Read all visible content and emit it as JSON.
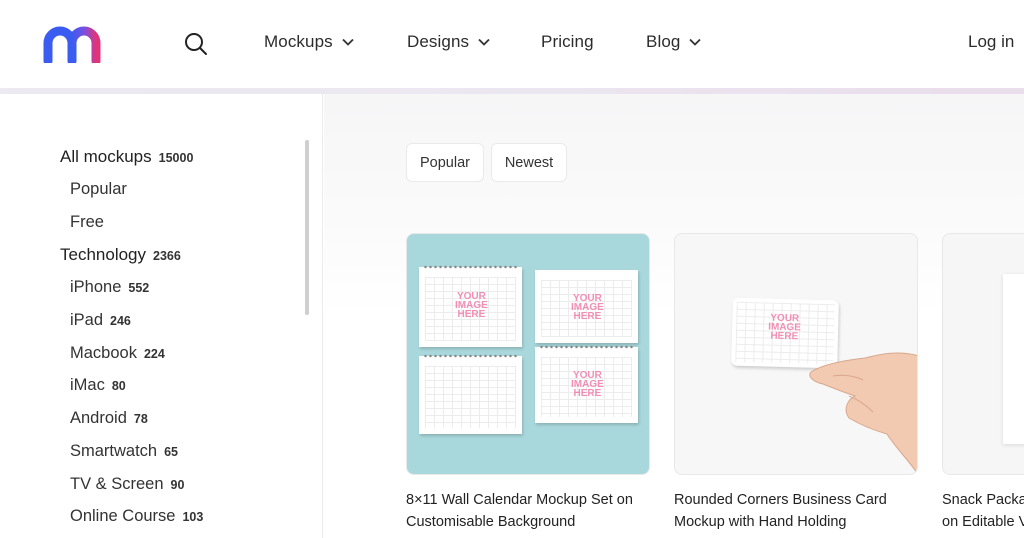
{
  "header": {
    "logo_icon": "mockup-m-logo",
    "search_icon": "search-icon",
    "nav": [
      {
        "label": "Mockups",
        "has_dropdown": true
      },
      {
        "label": "Designs",
        "has_dropdown": true
      },
      {
        "label": "Pricing",
        "has_dropdown": false
      },
      {
        "label": "Blog",
        "has_dropdown": true
      }
    ],
    "login_label": "Log in"
  },
  "sidebar": {
    "categories": [
      {
        "label": "All mockups",
        "count": "15000",
        "level": "top"
      },
      {
        "label": "Popular",
        "count": "",
        "level": "sub"
      },
      {
        "label": "Free",
        "count": "",
        "level": "sub"
      },
      {
        "label": "Technology",
        "count": "2366",
        "level": "top"
      },
      {
        "label": "iPhone",
        "count": "552",
        "level": "sub"
      },
      {
        "label": "iPad",
        "count": "246",
        "level": "sub"
      },
      {
        "label": "Macbook",
        "count": "224",
        "level": "sub"
      },
      {
        "label": "iMac",
        "count": "80",
        "level": "sub"
      },
      {
        "label": "Android",
        "count": "78",
        "level": "sub"
      },
      {
        "label": "Smartwatch",
        "count": "65",
        "level": "sub"
      },
      {
        "label": "TV & Screen",
        "count": "90",
        "level": "sub"
      },
      {
        "label": "Online Course",
        "count": "103",
        "level": "sub"
      }
    ]
  },
  "main": {
    "filters": [
      {
        "label": "Popular"
      },
      {
        "label": "Newest"
      }
    ],
    "placeholder_text": [
      "YOUR",
      "IMAGE",
      "HERE"
    ],
    "cards": [
      {
        "title_line1": "8×11 Wall Calendar Mockup Set on",
        "title_line2": "Customisable Background"
      },
      {
        "title_line1": "Rounded Corners Business Card",
        "title_line2": "Mockup with Hand Holding"
      },
      {
        "title_line1": "Snack Packa",
        "title_line2": "on Editable V"
      }
    ]
  },
  "colors": {
    "logo_blue": "#3b5cf0",
    "logo_pink": "#e0347a",
    "card1_bg": "#a9d8dc",
    "placeholder_pink": "#f06a9c"
  }
}
